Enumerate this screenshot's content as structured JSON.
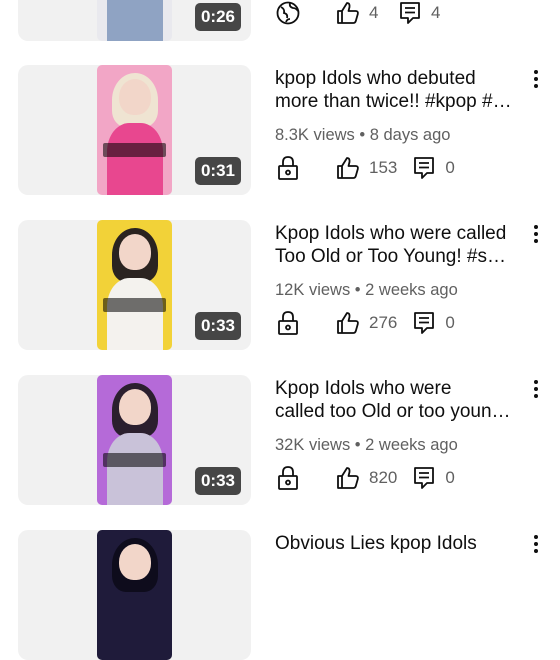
{
  "videos": [
    {
      "duration": "0:26",
      "title_line1": "",
      "title_line2": "",
      "meta": "",
      "likes": "4",
      "comments": "4",
      "privacy_icon": "globe-icon",
      "thumb_colors": {
        "bg": "#e9e9ee",
        "hair": "#c9c9cf",
        "body": "#8fa3c3"
      }
    },
    {
      "duration": "0:31",
      "title_line1": "kpop Idols who debuted",
      "title_line2": "more than twice!! #kpop #…",
      "meta": "8.3K views • 8 days ago",
      "likes": "153",
      "comments": "0",
      "privacy_icon": "lock-icon",
      "thumb_colors": {
        "bg": "#f2a6c6",
        "hair": "#efe4d2",
        "body": "#e8478f"
      }
    },
    {
      "duration": "0:33",
      "title_line1": "Kpop Idols who were called",
      "title_line2": "Too Old or Too Young! #s…",
      "meta": "12K views • 2 weeks ago",
      "likes": "276",
      "comments": "0",
      "privacy_icon": "lock-icon",
      "thumb_colors": {
        "bg": "#f2d238",
        "hair": "#2a2320",
        "body": "#f4f2ee"
      }
    },
    {
      "duration": "0:33",
      "title_line1": "Kpop Idols who were",
      "title_line2": "called too Old or too youn…",
      "meta": "32K views • 2 weeks ago",
      "likes": "820",
      "comments": "0",
      "privacy_icon": "lock-icon",
      "thumb_colors": {
        "bg": "#b56ad8",
        "hair": "#2b1f2e",
        "body": "#c9c2d9"
      }
    },
    {
      "duration": "",
      "title_line1": "Obvious Lies kpop Idols",
      "title_line2": "",
      "meta": "",
      "likes": "",
      "comments": "",
      "privacy_icon": "",
      "thumb_colors": {
        "bg": "#1f1b3a",
        "hair": "#0e0c1c",
        "body": "#3a2f63"
      }
    }
  ]
}
